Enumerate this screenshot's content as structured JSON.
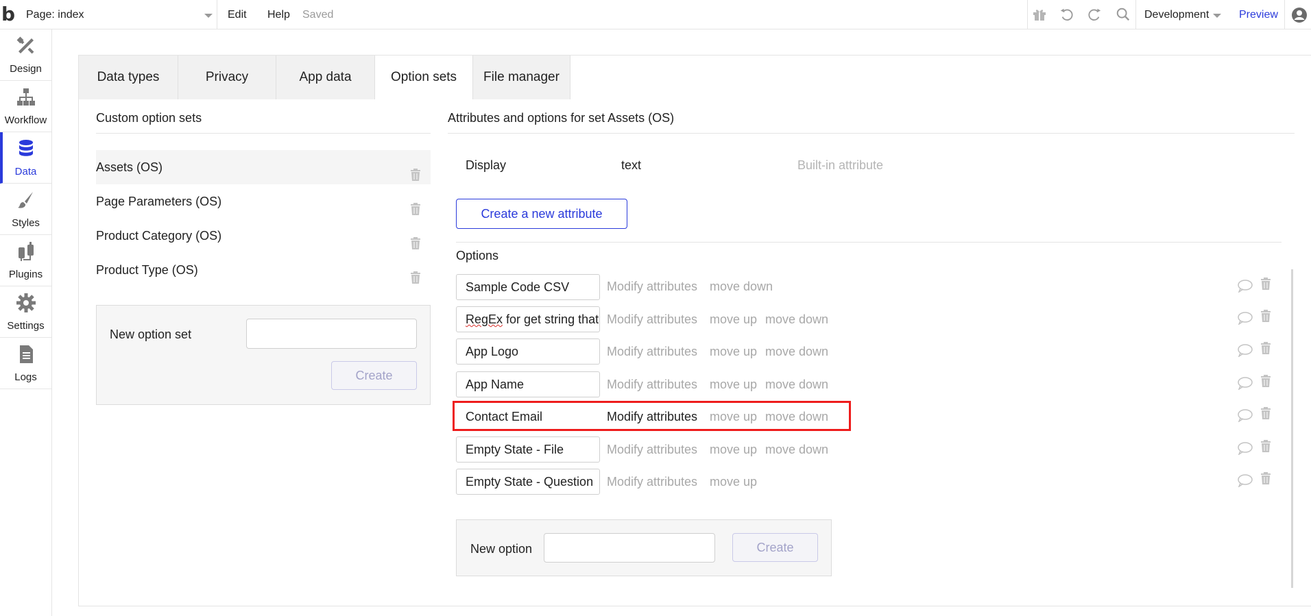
{
  "topbar": {
    "logo": "b",
    "page_select": "Page: index",
    "edit": "Edit",
    "help": "Help",
    "status": "Saved",
    "environment": "Development",
    "preview": "Preview",
    "icons": [
      "gift-icon",
      "undo-icon",
      "redo-icon",
      "search-icon",
      "user-icon"
    ]
  },
  "sidebar": {
    "items": [
      {
        "label": "Design",
        "icon": "design-tools-icon"
      },
      {
        "label": "Workflow",
        "icon": "workflow-icon"
      },
      {
        "label": "Data",
        "icon": "database-icon",
        "active": true
      },
      {
        "label": "Styles",
        "icon": "brush-icon"
      },
      {
        "label": "Plugins",
        "icon": "plug-icon"
      },
      {
        "label": "Settings",
        "icon": "gear-icon"
      },
      {
        "label": "Logs",
        "icon": "document-icon"
      }
    ]
  },
  "tabs": [
    {
      "label": "Data types"
    },
    {
      "label": "Privacy"
    },
    {
      "label": "App data"
    },
    {
      "label": "Option sets",
      "active": true
    },
    {
      "label": "File manager"
    }
  ],
  "left_panel": {
    "title": "Custom option sets",
    "option_sets": [
      {
        "label": "Assets (OS)",
        "selected": true
      },
      {
        "label": "Page Parameters (OS)"
      },
      {
        "label": "Product Category (OS)"
      },
      {
        "label": "Product Type (OS)"
      }
    ],
    "new_set_label": "New option set",
    "new_set_value": "",
    "create_label": "Create"
  },
  "right_panel": {
    "title": "Attributes and options for set Assets (OS)",
    "attribute": {
      "name": "Display",
      "type": "text",
      "note": "Built-in attribute"
    },
    "create_attribute_label": "Create a new attribute",
    "options_title": "Options",
    "modify_label": "Modify attributes",
    "move_up_label": "move up",
    "move_down_label": "move down",
    "options": [
      {
        "value": "Sample Code CSV",
        "move_up": false,
        "move_down": true
      },
      {
        "value": "RegEx for get string that",
        "move_up": true,
        "move_down": true
      },
      {
        "value": "App Logo",
        "move_up": true,
        "move_down": true
      },
      {
        "value": "App Name",
        "move_up": true,
        "move_down": true
      },
      {
        "value": "Contact Email",
        "move_up": true,
        "move_down": true,
        "hovered": true,
        "highlighted": true
      },
      {
        "value": "Empty State - File",
        "move_up": true,
        "move_down": true
      },
      {
        "value": "Empty State - Question",
        "move_up": true,
        "move_down": false
      }
    ],
    "new_option_label": "New option",
    "new_option_value": "",
    "create_label": "Create"
  },
  "colors": {
    "accent": "#2a3adb",
    "muted_text": "#a8a8a8",
    "highlight": "#ee1c1c"
  }
}
